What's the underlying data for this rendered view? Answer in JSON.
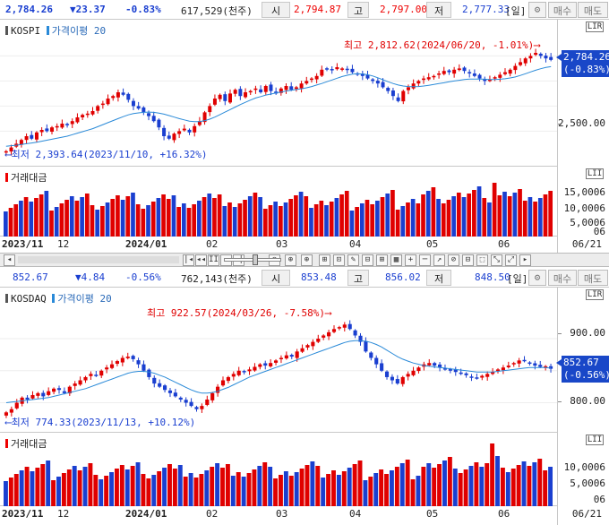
{
  "top": {
    "index_value": "2,784.26",
    "change": "▼23.37",
    "change_pct": "-0.83%",
    "volume": "617,529(천주)",
    "open_label": "시",
    "open": "2,794.87",
    "high_label": "고",
    "high": "2,797.00",
    "low_label": "저",
    "low": "2,777.33",
    "period": "[일]",
    "buy_label": "매수",
    "sell_label": "매도",
    "title": "KOSPI",
    "indicator": "가격이평 20",
    "volume_title": "거래대금",
    "max_annotation": "최고 2,812.62(2024/06/20, -1.01%)",
    "min_annotation": "최저 2,393.64(2023/11/10, +16.32%)",
    "y_ticks": [
      "2,500.00"
    ],
    "vol_ticks": [
      "15,0006",
      "10,0006",
      "5,0006",
      "06"
    ],
    "price_tag": [
      "2,784.26",
      "(-0.83%)"
    ],
    "x_labels": [
      "2023/11",
      "12",
      "2024/01",
      "02",
      "03",
      "04",
      "05",
      "06"
    ],
    "x_right": "06/21",
    "corner1": "LIR",
    "corner2": "LII"
  },
  "bottom": {
    "index_value": "852.67",
    "change": "▼4.84",
    "change_pct": "-0.56%",
    "volume": "762,143(천주)",
    "open": "853.48",
    "high": "856.02",
    "low": "848.50",
    "period": "[일]",
    "buy_label": "매수",
    "sell_label": "매도",
    "title": "KOSDAQ",
    "indicator": "가격이평 20",
    "volume_title": "거래대금",
    "max_annotation": "최고 922.57(2024/03/26, -7.58%)",
    "min_annotation": "최저 774.33(2023/11/13, +10.12%)",
    "y_ticks": [
      "900.00",
      "800.00"
    ],
    "vol_ticks": [
      "10,0006",
      "5,0006",
      "06"
    ],
    "price_tag": [
      "852.67",
      "(-0.56%)"
    ],
    "x_labels": [
      "2023/11",
      "12",
      "2024/01",
      "02",
      "03",
      "04",
      "05",
      "06"
    ],
    "x_right": "06/21",
    "corner1": "LIR",
    "corner2": "LII"
  },
  "toolbar": {
    "buttons": [
      "◂",
      "|◂",
      "◂◂",
      "II",
      "▸",
      "▸|",
      "⊖",
      "⊕",
      "⊕",
      "⊞",
      "⊡",
      "✎",
      "⊟",
      "⊞",
      "▦",
      "+",
      "─",
      "↗",
      "⊘",
      "⊟",
      "⬚",
      "⤡",
      "⤢",
      "▸"
    ]
  },
  "colors": {
    "up": "#e00000",
    "down": "#1a3fd0",
    "ma": "#2a8ad8"
  },
  "chart_data": [
    {
      "type": "candlestick",
      "title": "KOSPI",
      "series": [
        {
          "name": "가격이평 20"
        }
      ],
      "x_labels": [
        "2023/11",
        "12",
        "2024/01",
        "02",
        "03",
        "04",
        "05",
        "06"
      ],
      "ylim": [
        2380,
        2830
      ],
      "max": 2812.62,
      "min": 2393.64,
      "close": [
        2420,
        2435,
        2450,
        2465,
        2480,
        2470,
        2495,
        2505,
        2500,
        2515,
        2520,
        2530,
        2525,
        2540,
        2555,
        2565,
        2570,
        2580,
        2600,
        2610,
        2630,
        2640,
        2655,
        2645,
        2625,
        2600,
        2590,
        2575,
        2560,
        2540,
        2515,
        2480,
        2470,
        2490,
        2500,
        2510,
        2495,
        2520,
        2540,
        2575,
        2600,
        2630,
        2645,
        2620,
        2650,
        2665,
        2640,
        2655,
        2660,
        2670,
        2655,
        2680,
        2660,
        2650,
        2670,
        2680,
        2665,
        2675,
        2690,
        2700,
        2710,
        2720,
        2745,
        2750,
        2745,
        2755,
        2750,
        2745,
        2735,
        2730,
        2720,
        2710,
        2700,
        2690,
        2675,
        2660,
        2640,
        2620,
        2660,
        2675,
        2690,
        2700,
        2710,
        2715,
        2720,
        2730,
        2740,
        2735,
        2745,
        2750,
        2740,
        2730,
        2720,
        2710,
        2700,
        2705,
        2715,
        2725,
        2735,
        2745,
        2760,
        2775,
        2790,
        2800,
        2812,
        2800,
        2790,
        2784
      ],
      "ma": [
        2440,
        2442,
        2444,
        2447,
        2450,
        2453,
        2456,
        2460,
        2464,
        2468,
        2472,
        2476,
        2480,
        2486,
        2492,
        2498,
        2504,
        2510,
        2518,
        2526,
        2534,
        2542,
        2550,
        2558,
        2565,
        2570,
        2573,
        2575,
        2576,
        2575,
        2572,
        2568,
        2562,
        2556,
        2550,
        2545,
        2540,
        2538,
        2538,
        2542,
        2548,
        2556,
        2566,
        2576,
        2586,
        2596,
        2606,
        2615,
        2624,
        2632,
        2638,
        2644,
        2648,
        2652,
        2656,
        2660,
        2663,
        2666,
        2669,
        2673,
        2678,
        2684,
        2690,
        2697,
        2704,
        2711,
        2718,
        2723,
        2727,
        2729,
        2728,
        2725,
        2720,
        2713,
        2705,
        2697,
        2690,
        2684,
        2680,
        2678,
        2677,
        2678,
        2680,
        2683,
        2686,
        2690,
        2693,
        2697,
        2700,
        2703,
        2706,
        2708,
        2708,
        2708,
        2707,
        2706,
        2706,
        2707,
        2709,
        2712,
        2716,
        2722,
        2729,
        2736,
        2743,
        2749,
        2754,
        2757
      ]
    },
    {
      "type": "candlestick",
      "title": "KOSDAQ",
      "series": [
        {
          "name": "가격이평 20"
        }
      ],
      "x_labels": [
        "2023/11",
        "12",
        "2024/01",
        "02",
        "03",
        "04",
        "05",
        "06"
      ],
      "ylim": [
        770,
        935
      ],
      "max": 922.57,
      "min": 774.33,
      "close": [
        785,
        790,
        800,
        808,
        805,
        812,
        815,
        810,
        818,
        822,
        820,
        815,
        825,
        830,
        835,
        840,
        845,
        842,
        850,
        855,
        860,
        865,
        870,
        872,
        868,
        860,
        850,
        840,
        830,
        825,
        820,
        815,
        810,
        805,
        800,
        795,
        790,
        795,
        805,
        815,
        825,
        835,
        840,
        845,
        850,
        848,
        852,
        856,
        860,
        858,
        862,
        866,
        870,
        874,
        872,
        880,
        885,
        890,
        895,
        900,
        905,
        910,
        915,
        918,
        922,
        915,
        905,
        895,
        880,
        870,
        860,
        850,
        840,
        835,
        830,
        840,
        845,
        850,
        855,
        860,
        862,
        858,
        855,
        852,
        850,
        848,
        845,
        843,
        840,
        838,
        842,
        845,
        848,
        852,
        855,
        858,
        862,
        866,
        865,
        862,
        858,
        856,
        857,
        853
      ],
      "ma": [
        800,
        801,
        802,
        803,
        804,
        805,
        806,
        807,
        808,
        810,
        812,
        814,
        816,
        818,
        820,
        822,
        825,
        828,
        831,
        834,
        837,
        840,
        843,
        846,
        848,
        849,
        849,
        848,
        846,
        843,
        840,
        836,
        832,
        828,
        824,
        820,
        817,
        815,
        815,
        816,
        818,
        821,
        824,
        828,
        832,
        836,
        840,
        843,
        846,
        849,
        852,
        855,
        858,
        861,
        864,
        867,
        870,
        873,
        876,
        879,
        882,
        885,
        888,
        891,
        894,
        896,
        897,
        897,
        896,
        894,
        891,
        887,
        882,
        877,
        872,
        868,
        865,
        862,
        860,
        858,
        857,
        856,
        855,
        854,
        853,
        852,
        851,
        850,
        849,
        848,
        848,
        848,
        848,
        849,
        850,
        851,
        852,
        853,
        854,
        855,
        855,
        855,
        855,
        854
      ]
    }
  ]
}
